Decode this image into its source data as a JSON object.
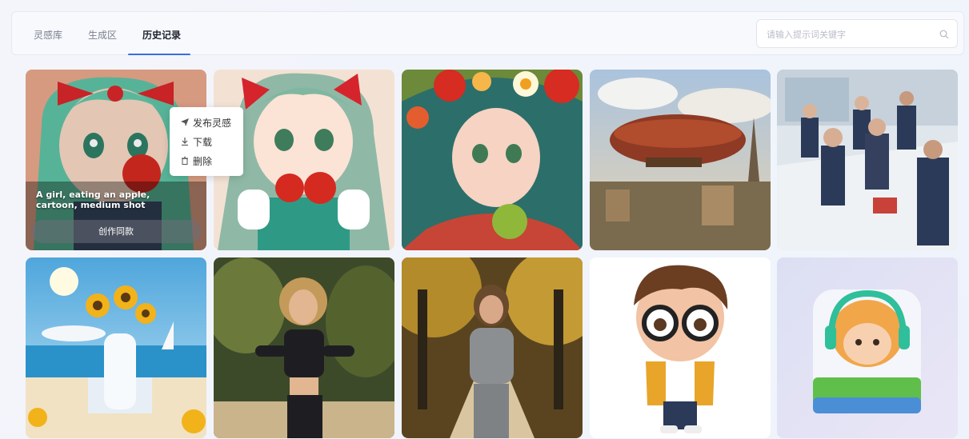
{
  "tabs": [
    {
      "label": "灵感库",
      "active": false
    },
    {
      "label": "生成区",
      "active": false
    },
    {
      "label": "历史记录",
      "active": true
    }
  ],
  "search": {
    "placeholder": "请输入提示词关键字",
    "icon": "search-icon"
  },
  "hover_card": {
    "caption": "A girl, eating an apple, cartoon, medium shot",
    "create_button": "创作同款"
  },
  "context_menu": [
    {
      "label": "发布灵感",
      "icon": "send-icon"
    },
    {
      "label": "下载",
      "icon": "download-icon"
    },
    {
      "label": "删除",
      "icon": "trash-icon"
    }
  ],
  "images": [
    {
      "subject": "anime girl with red bows eating apple"
    },
    {
      "subject": "anime girl holding apples"
    },
    {
      "subject": "girl with flower crown and apple"
    },
    {
      "subject": "steampunk airship over city"
    },
    {
      "subject": "business people in office"
    },
    {
      "subject": "sunscreen bottle with sunflowers on beach"
    },
    {
      "subject": "woman running in park"
    },
    {
      "subject": "woman jogging on autumn path"
    },
    {
      "subject": "3d cartoon boy with glasses"
    },
    {
      "subject": "3d game icon character with headphones"
    }
  ],
  "accent_color": "#3a6de0"
}
